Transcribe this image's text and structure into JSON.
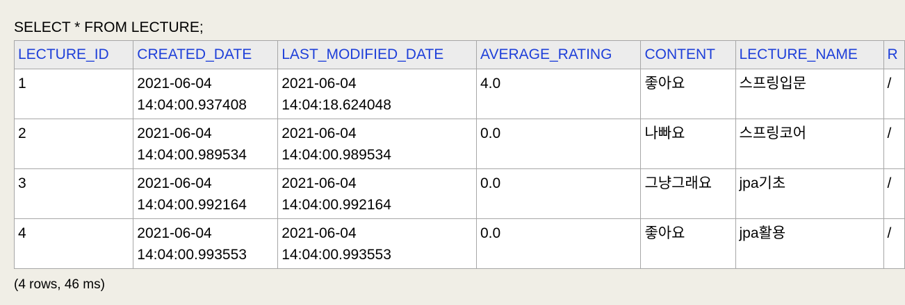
{
  "query": "SELECT * FROM LECTURE;",
  "table": {
    "columns": [
      "LECTURE_ID",
      "CREATED_DATE",
      "LAST_MODIFIED_DATE",
      "AVERAGE_RATING",
      "CONTENT",
      "LECTURE_NAME",
      "R"
    ],
    "rows": [
      {
        "id": "1",
        "created_date": "2021-06-04",
        "created_time": "14:04:00.937408",
        "modified_date": "2021-06-04",
        "modified_time": "14:04:18.624048",
        "rating": "4.0",
        "content": "좋아요",
        "name": "스프링입문",
        "extra": "/"
      },
      {
        "id": "2",
        "created_date": "2021-06-04",
        "created_time": "14:04:00.989534",
        "modified_date": "2021-06-04",
        "modified_time": "14:04:00.989534",
        "rating": "0.0",
        "content": "나빠요",
        "name": "스프링코어",
        "extra": "/"
      },
      {
        "id": "3",
        "created_date": "2021-06-04",
        "created_time": "14:04:00.992164",
        "modified_date": "2021-06-04",
        "modified_time": "14:04:00.992164",
        "rating": "0.0",
        "content": "그냥그래요",
        "name": "jpa기초",
        "extra": "/"
      },
      {
        "id": "4",
        "created_date": "2021-06-04",
        "created_time": "14:04:00.993553",
        "modified_date": "2021-06-04",
        "modified_time": "14:04:00.993553",
        "rating": "0.0",
        "content": "좋아요",
        "name": "jpa활용",
        "extra": "/"
      }
    ]
  },
  "footer": "(4 rows, 46 ms)",
  "colors": {
    "header_text": "#1e3fd9",
    "background": "#f0eee6"
  }
}
